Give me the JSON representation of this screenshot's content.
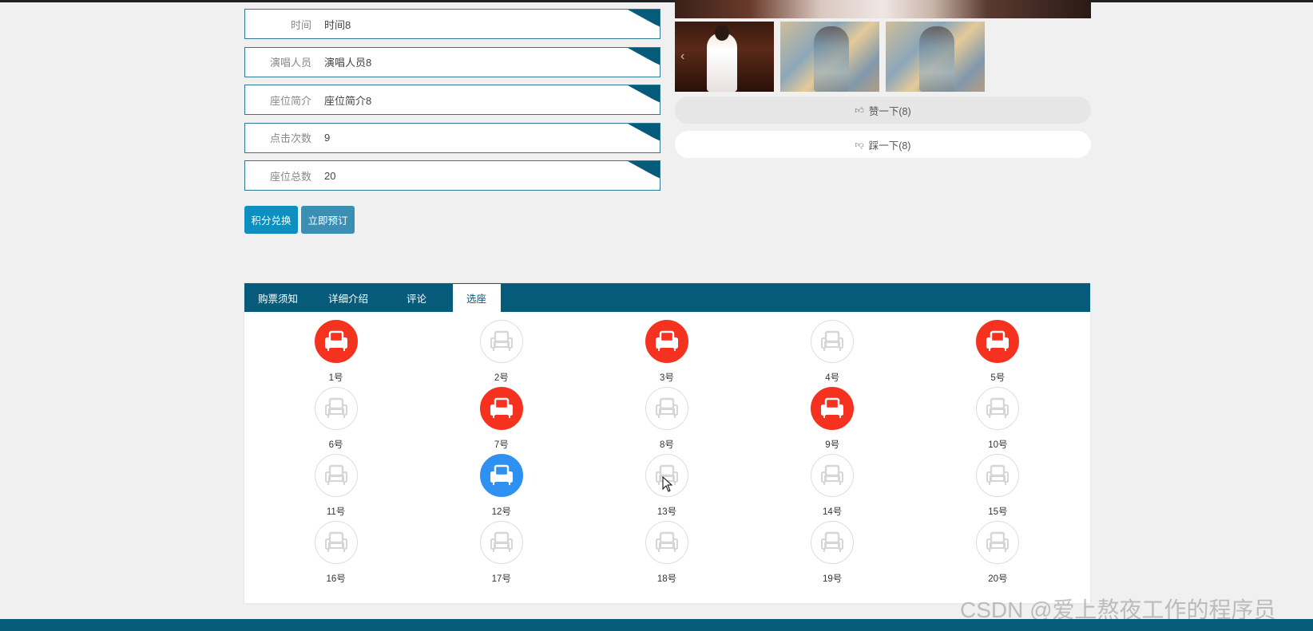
{
  "info": {
    "rows": [
      {
        "label": "时间",
        "value": "时间8"
      },
      {
        "label": "演唱人员",
        "value": "演唱人员8"
      },
      {
        "label": "座位简介",
        "value": "座位简介8"
      },
      {
        "label": "点击次数",
        "value": "9"
      },
      {
        "label": "座位总数",
        "value": "20"
      }
    ]
  },
  "buttons": {
    "exchange": "积分兑换",
    "book": "立即预订"
  },
  "reactions": {
    "like": "赞一下(8)",
    "dislike": "踩一下(8)"
  },
  "tabs": [
    "购票须知",
    "详细介绍",
    "评论",
    "选座"
  ],
  "active_tab": "选座",
  "seats": [
    {
      "label": "1号",
      "status": "sold"
    },
    {
      "label": "2号",
      "status": "available"
    },
    {
      "label": "3号",
      "status": "sold"
    },
    {
      "label": "4号",
      "status": "available"
    },
    {
      "label": "5号",
      "status": "sold"
    },
    {
      "label": "6号",
      "status": "available"
    },
    {
      "label": "7号",
      "status": "sold"
    },
    {
      "label": "8号",
      "status": "available"
    },
    {
      "label": "9号",
      "status": "sold"
    },
    {
      "label": "10号",
      "status": "available"
    },
    {
      "label": "11号",
      "status": "available"
    },
    {
      "label": "12号",
      "status": "selected"
    },
    {
      "label": "13号",
      "status": "available"
    },
    {
      "label": "14号",
      "status": "available"
    },
    {
      "label": "15号",
      "status": "available"
    },
    {
      "label": "16号",
      "status": "available"
    },
    {
      "label": "17号",
      "status": "available"
    },
    {
      "label": "18号",
      "status": "available"
    },
    {
      "label": "19号",
      "status": "available"
    },
    {
      "label": "20号",
      "status": "available"
    }
  ],
  "colors": {
    "theme": "#075b7a",
    "sold": "#f4321f",
    "selected": "#2e90f0",
    "available_border": "#dddddd"
  },
  "watermark": "CSDN @爱上熬夜工作的程序员"
}
